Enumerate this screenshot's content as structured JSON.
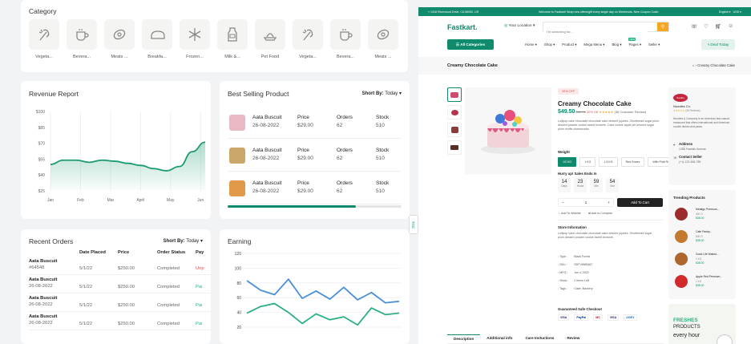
{
  "category": {
    "title": "Category",
    "items": [
      {
        "label": "Vegeta...",
        "icon": "vegetable-icon"
      },
      {
        "label": "Bevera...",
        "icon": "cup-icon"
      },
      {
        "label": "Meats ...",
        "icon": "meat-icon"
      },
      {
        "label": "Breakfa...",
        "icon": "bread-icon"
      },
      {
        "label": "Frozen...",
        "icon": "snowflake-icon"
      },
      {
        "label": "Milk &...",
        "icon": "milk-icon"
      },
      {
        "label": "Pet Food",
        "icon": "pet-food-icon"
      },
      {
        "label": "Vegeta...",
        "icon": "vegetable-icon"
      },
      {
        "label": "Bevera...",
        "icon": "cup-icon"
      },
      {
        "label": "Meats ...",
        "icon": "meat-icon"
      }
    ]
  },
  "revenue": {
    "title": "Revenue Report",
    "chart_data": {
      "type": "area",
      "title": "Revenue Report",
      "categories": [
        "Jan",
        "Feb",
        "Mar",
        "April",
        "May",
        "Jun"
      ],
      "yticks": [
        "$100",
        "$85",
        "$70",
        "$55",
        "$40",
        "$25"
      ],
      "ylim": [
        25,
        100
      ],
      "series": [
        {
          "values": [
            50,
            54,
            54,
            52,
            54,
            53,
            51,
            49,
            46,
            44,
            48,
            62,
            71
          ]
        }
      ]
    }
  },
  "best_selling": {
    "title": "Best Selling Product",
    "sort_label": "Short By:",
    "sort_value": "Today",
    "columns": [
      "Price",
      "Orders",
      "Stock"
    ],
    "rows": [
      {
        "name": "Aata Buscuit",
        "date": "26-08-2022",
        "price": "$29.00",
        "orders": "62",
        "stock": "510"
      },
      {
        "name": "Aata Buscuit",
        "date": "26-08-2022",
        "price": "$29.00",
        "orders": "62",
        "stock": "510"
      },
      {
        "name": "Aata Buscuit",
        "date": "26-08-2022",
        "price": "$29.00",
        "orders": "62",
        "stock": "510"
      }
    ]
  },
  "recent_orders": {
    "title": "Recent Orders",
    "sort_label": "Short By:",
    "sort_value": "Today",
    "columns": [
      "Date Placed",
      "Price",
      "Order Status",
      "Pay"
    ],
    "rows": [
      {
        "name": "Aata Buscuit",
        "id": "#64548",
        "date": "5/1/22",
        "price": "$250.00",
        "status": "Completed",
        "pay": "Unp"
      },
      {
        "name": "Aata Buscuit",
        "id": "26-08-2022",
        "date": "5/1/22",
        "price": "$250.00",
        "status": "Completed",
        "pay": "Pai"
      },
      {
        "name": "Aata Buscuit",
        "id": "26-08-2022",
        "date": "5/1/22",
        "price": "$250.00",
        "status": "Completed",
        "pay": "Pai"
      },
      {
        "name": "Aata Buscuit",
        "id": "26-08-2022",
        "date": "5/1/22",
        "price": "$250.00",
        "status": "Completed",
        "pay": "Pai"
      }
    ]
  },
  "earning": {
    "title": "Earning",
    "chart_data": {
      "type": "line",
      "title": "Earning",
      "yticks": [
        "120",
        "100",
        "80",
        "60",
        "40",
        "20"
      ],
      "ylim": [
        20,
        120
      ],
      "series": [
        {
          "color": "#4a90d9",
          "values": [
            83,
            70,
            64,
            85,
            59,
            69,
            58,
            74,
            57,
            67,
            53,
            55
          ]
        },
        {
          "color": "#2bb07f",
          "values": [
            39,
            48,
            52,
            40,
            25,
            38,
            30,
            34,
            23,
            46,
            37,
            39
          ]
        }
      ]
    }
  },
  "shop": {
    "topbar_address": "1418 Riverwood Drive, CA 96052, US",
    "topbar_promo": "Welcome to Fastkart! Wrap new offers/gift every single day on Weekends. New Coupon Code:",
    "topbar_lang": "English",
    "topbar_currency": "USD",
    "logo": "Fastkart.",
    "location": "Your Location",
    "search_placeholder": "I'm searching for...",
    "all_categories": "All Categories",
    "nav": [
      "Home",
      "Shop",
      "Product",
      "Mega Menu",
      "Blog",
      "Pages",
      "Seller"
    ],
    "pages_badge": "NEW",
    "deal": "Deal Today",
    "breadcrumb_title": "Creamy Chocolate Cake",
    "breadcrumb_path": "Creamy Chocolate Cake",
    "discount_badge": "30% OFF",
    "product_title": "Creamy Chocolate Cake",
    "price": "$49.50",
    "old_price": "$68.00",
    "off": "30% Off",
    "reviews": "(36 Customer Review)",
    "description": "Lollipop cake chocolate chocolate cake dessert jujubes. Shortbread sugar plum dessert powder cookie sweet brownie. Cake cookie apple pie dessert sugar plum muffin cheesecake.",
    "weight_label": "Weight",
    "weights": [
      "1/2 KG",
      "1 KG",
      "1.5 KG",
      "Red Roses",
      "With Pink Roses"
    ],
    "hurry": "Hurry up! Sales Ends In",
    "countdown": [
      {
        "v": "14",
        "l": "Days"
      },
      {
        "v": "23",
        "l": "Hours"
      },
      {
        "v": "59",
        "l": "Min"
      },
      {
        "v": "54",
        "l": "Sec"
      }
    ],
    "qty": "1",
    "add_to_cart": "Add To Cart",
    "wishlist": "Add To Wishlist",
    "compare": "Add to Compare",
    "store_info_title": "Store Information",
    "store_info": "Lollipop cake chocolate chocolate cake dessert jujubes. Shortbread sugar plum dessert powder cookie sweet brownie.",
    "specs": [
      {
        "k": "Type :",
        "v": "Black Forest"
      },
      {
        "k": "SKU :",
        "v": "SDFVW65467"
      },
      {
        "k": "MFG :",
        "v": "Jun 4, 2022"
      },
      {
        "k": "Stock :",
        "v": "2 Items Left"
      },
      {
        "k": "Tags :",
        "v": "Cake, Backery"
      }
    ],
    "guaranteed": "Guaranteed Safe Checkout",
    "payments": [
      "VISA",
      "PayPal",
      "MC",
      "VISA",
      "AMEX"
    ],
    "tabs": [
      "Description",
      "Additional info",
      "Care Instuctions",
      "Review"
    ],
    "seller_name": "Noodles Co.",
    "seller_reviews": "(36 Reviews)",
    "seller_desc": "Noodles & Company is an American fast-casual restaurant that offers international and American noodle dishes and pasta.",
    "address_label": "Address",
    "address": "1288 Franklin Avenue",
    "contact_label": "Contact Seller",
    "contact": "(+1)-123-456-789",
    "trending_title": "Trending Products",
    "trending": [
      {
        "name": "Meatigo Premium...",
        "w": "400 G",
        "p": "$38.00"
      },
      {
        "name": "Cafe Pastry...",
        "w": "500 G",
        "p": "$38.00"
      },
      {
        "name": "Good Life Walnut...",
        "w": "1 KG",
        "p": "$38.00"
      },
      {
        "name": "Apple Red Premium...",
        "w": "1 KG",
        "p": "$38.00"
      }
    ],
    "banner_fresh": "FRESHES",
    "banner_products": "PRODUCTS",
    "banner_hour": "every hour",
    "toc": "TOC"
  }
}
